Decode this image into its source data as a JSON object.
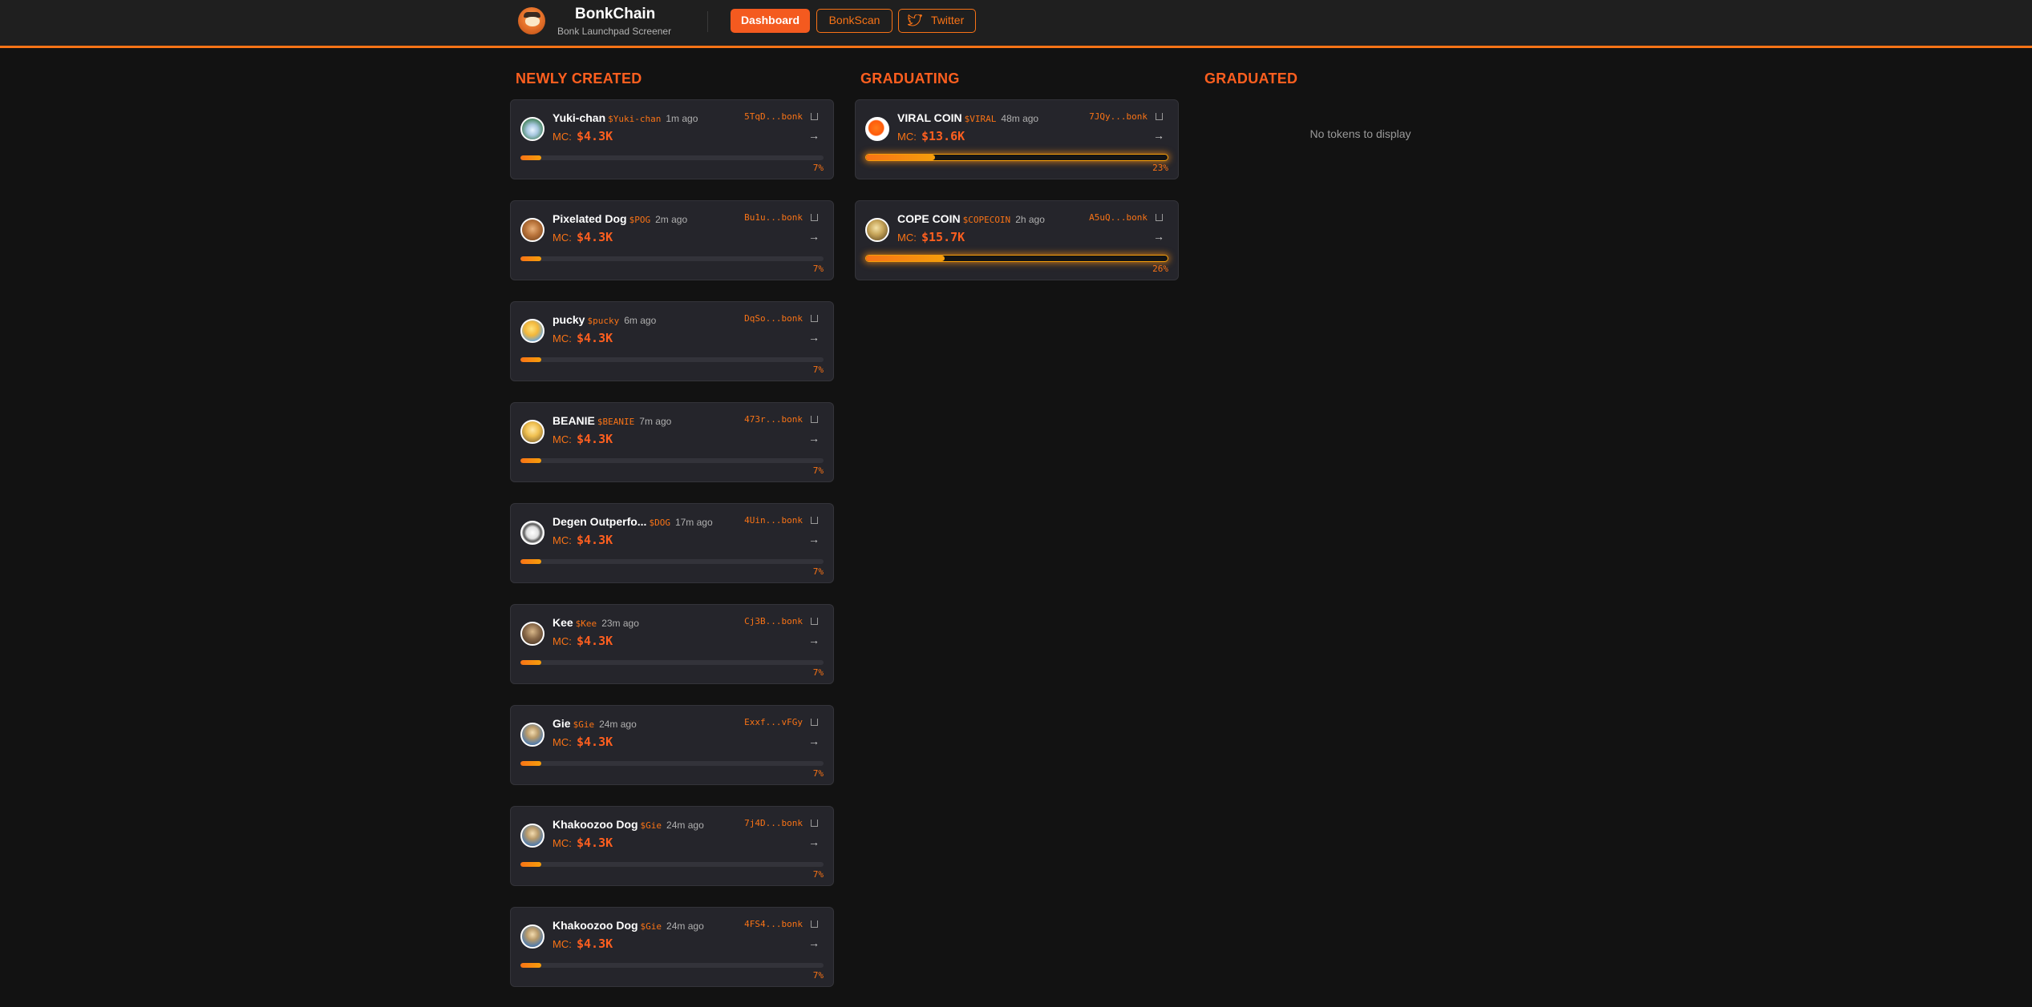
{
  "header": {
    "brand_title": "BonkChain",
    "brand_subtitle": "Bonk Launchpad Screener",
    "nav": {
      "dashboard": "Dashboard",
      "bonkscan": "BonkScan",
      "twitter": "Twitter"
    }
  },
  "colors": {
    "accent": "#f97316",
    "accent_strong": "#ff5f1f",
    "background": "#121212",
    "card": "#25252b"
  },
  "columns": {
    "newly_created": {
      "title": "NEWLY CREATED",
      "tokens": [
        {
          "name": "Yuki-chan",
          "ticker": "$Yuki-chan",
          "age": "1m ago",
          "mc_label": "MC:",
          "mc": "$4.3K",
          "address": "5TqD...bonk",
          "progress": "7%",
          "progress_value": 7,
          "avatar": "snowman-avatar"
        },
        {
          "name": "Pixelated Dog",
          "ticker": "$POG",
          "age": "2m ago",
          "mc_label": "MC:",
          "mc": "$4.3K",
          "address": "Bu1u...bonk",
          "progress": "7%",
          "progress_value": 7,
          "avatar": "dog-avatar"
        },
        {
          "name": "pucky",
          "ticker": "$pucky",
          "age": "6m ago",
          "mc_label": "MC:",
          "mc": "$4.3K",
          "address": "DqSo...bonk",
          "progress": "7%",
          "progress_value": 7,
          "avatar": "cartoon-avatar"
        },
        {
          "name": "BEANIE",
          "ticker": "$BEANIE",
          "age": "7m ago",
          "mc_label": "MC:",
          "mc": "$4.3K",
          "address": "473r...bonk",
          "progress": "7%",
          "progress_value": 7,
          "avatar": "beanie-avatar"
        },
        {
          "name": "Degen Outperfo...",
          "ticker": "$DOG",
          "age": "17m ago",
          "mc_label": "MC:",
          "mc": "$4.3K",
          "address": "4Uin...bonk",
          "progress": "7%",
          "progress_value": 7,
          "avatar": "sketch-avatar"
        },
        {
          "name": "Kee",
          "ticker": "$Kee",
          "age": "23m ago",
          "mc_label": "MC:",
          "mc": "$4.3K",
          "address": "Cj3B...bonk",
          "progress": "7%",
          "progress_value": 7,
          "avatar": "photo-avatar"
        },
        {
          "name": "Gie",
          "ticker": "$Gie",
          "age": "24m ago",
          "mc_label": "MC:",
          "mc": "$4.3K",
          "address": "Exxf...vFGy",
          "progress": "7%",
          "progress_value": 7,
          "avatar": "figure-avatar"
        },
        {
          "name": "Khakoozoo Dog",
          "ticker": "$Gie",
          "age": "24m ago",
          "mc_label": "MC:",
          "mc": "$4.3K",
          "address": "7j4D...bonk",
          "progress": "7%",
          "progress_value": 7,
          "avatar": "figure-avatar"
        },
        {
          "name": "Khakoozoo Dog",
          "ticker": "$Gie",
          "age": "24m ago",
          "mc_label": "MC:",
          "mc": "$4.3K",
          "address": "4FS4...bonk",
          "progress": "7%",
          "progress_value": 7,
          "avatar": "figure-avatar"
        }
      ]
    },
    "graduating": {
      "title": "GRADUATING",
      "tokens": [
        {
          "name": "VIRAL COIN",
          "ticker": "$VIRAL",
          "age": "48m ago",
          "mc_label": "MC:",
          "mc": "$13.6K",
          "address": "7JQy...bonk",
          "progress": "23%",
          "progress_value": 23,
          "avatar": "orange-blob-avatar"
        },
        {
          "name": "COPE COIN",
          "ticker": "$COPECOIN",
          "age": "2h ago",
          "mc_label": "MC:",
          "mc": "$15.7K",
          "address": "A5uQ...bonk",
          "progress": "26%",
          "progress_value": 26,
          "avatar": "gold-coin-avatar"
        }
      ]
    },
    "graduated": {
      "title": "GRADUATED",
      "empty_message": "No tokens to display"
    }
  }
}
